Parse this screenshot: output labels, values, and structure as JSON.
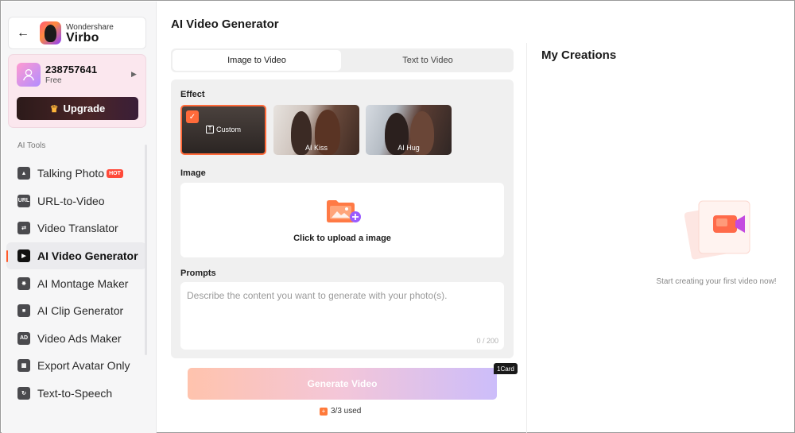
{
  "brand": {
    "company": "Wondershare",
    "product": "Virbo"
  },
  "account": {
    "id": "238757641",
    "plan": "Free",
    "upgrade_label": "Upgrade"
  },
  "sidebar": {
    "section_label": "AI Tools",
    "items": [
      {
        "label": "Talking Photo",
        "badge": "HOT",
        "icon": "image-icon"
      },
      {
        "label": "URL-to-Video",
        "icon": "url-icon"
      },
      {
        "label": "Video Translator",
        "icon": "translate-icon"
      },
      {
        "label": "AI Video Generator",
        "icon": "video-generator-icon",
        "active": true
      },
      {
        "label": "AI Montage Maker",
        "icon": "montage-icon"
      },
      {
        "label": "AI Clip Generator",
        "icon": "clip-icon"
      },
      {
        "label": "Video Ads Maker",
        "icon": "ad-icon"
      },
      {
        "label": "Export Avatar Only",
        "icon": "avatar-export-icon"
      },
      {
        "label": "Text-to-Speech",
        "icon": "speech-icon"
      }
    ]
  },
  "main": {
    "title": "AI Video Generator",
    "tabs": [
      {
        "label": "Image to Video",
        "selected": true
      },
      {
        "label": "Text to Video",
        "selected": false
      }
    ],
    "effect_label": "Effect",
    "effects": [
      {
        "label": "Custom",
        "selected": true
      },
      {
        "label": "AI Kiss"
      },
      {
        "label": "AI Hug"
      }
    ],
    "image_label": "Image",
    "upload_text": "Click to upload a image",
    "prompts_label": "Prompts",
    "prompt_placeholder": "Describe the content you want to generate with your photo(s).",
    "prompt_counter": "0 / 200",
    "generate_label": "Generate Video",
    "card_badge": "1Card",
    "usage": "3/3 used"
  },
  "right": {
    "title": "My Creations",
    "empty_text": "Start creating your first video now!"
  },
  "colors": {
    "accent": "#ff6a3a",
    "hot": "#ff4a3a",
    "upgrade_bg": "#3a2022"
  }
}
